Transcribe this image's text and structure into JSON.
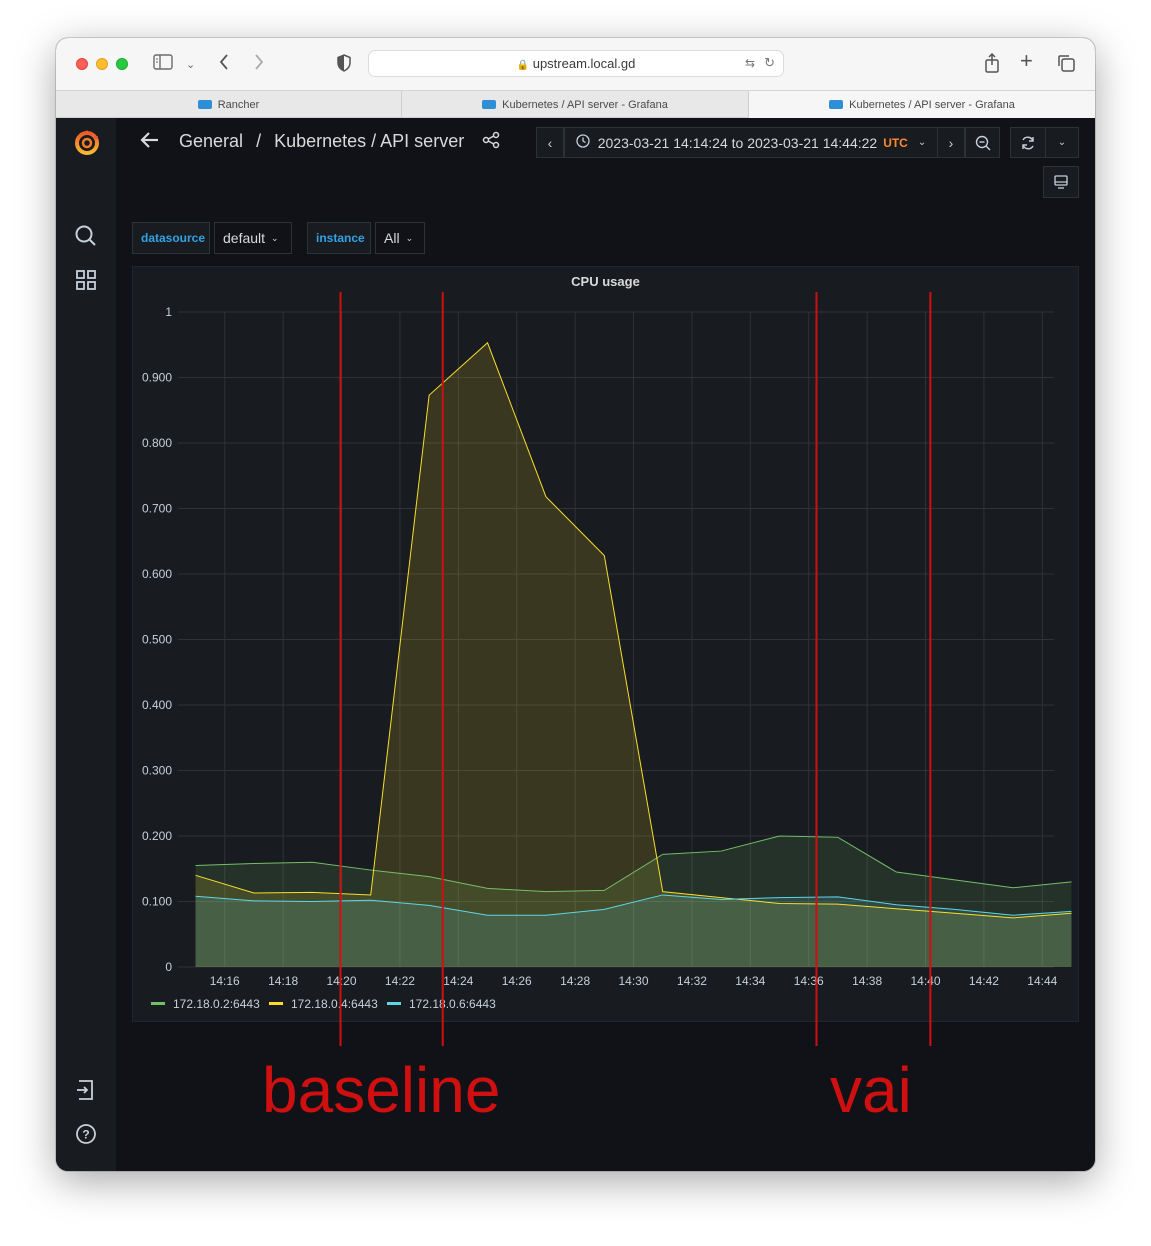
{
  "browser": {
    "url": "upstream.local.gd",
    "tabs": [
      {
        "label": "Rancher",
        "active": false
      },
      {
        "label": "Kubernetes / API server - Grafana",
        "active": false
      },
      {
        "label": "Kubernetes / API server - Grafana",
        "active": true
      }
    ]
  },
  "header": {
    "breadcrumb_folder": "General",
    "breadcrumb_sep": "/",
    "dashboard_title": "Kubernetes / API server",
    "time_range": "2023-03-21 14:14:24 to 2023-03-21 14:44:22",
    "timezone": "UTC"
  },
  "variables": [
    {
      "label": "datasource",
      "value": "default"
    },
    {
      "label": "instance",
      "value": "All"
    }
  ],
  "panel": {
    "title": "CPU usage"
  },
  "annotations": {
    "left_label": "baseline",
    "right_label": "vai",
    "color": "#d01010",
    "marker_times": [
      "14:20",
      "14:23.5",
      "14:36.3",
      "14:40.2"
    ]
  },
  "colors": {
    "series_green": "#73bf69",
    "series_yellow": "#fade2a",
    "series_blue": "#5fd6e8",
    "accent_orange": "#ff8833",
    "link_blue": "#33a2e5"
  },
  "chart_data": {
    "type": "area",
    "title": "CPU usage",
    "x": [
      "14:15",
      "14:17",
      "14:19",
      "14:21",
      "14:23",
      "14:25",
      "14:27",
      "14:29",
      "14:31",
      "14:33",
      "14:35",
      "14:37",
      "14:39",
      "14:41",
      "14:43",
      "14:45"
    ],
    "x_ticks": [
      "14:16",
      "14:18",
      "14:20",
      "14:22",
      "14:24",
      "14:26",
      "14:28",
      "14:30",
      "14:32",
      "14:34",
      "14:36",
      "14:38",
      "14:40",
      "14:42",
      "14:44"
    ],
    "y_ticks": [
      "0",
      "0.100",
      "0.200",
      "0.300",
      "0.400",
      "0.500",
      "0.600",
      "0.700",
      "0.800",
      "0.900",
      "1"
    ],
    "ylim": [
      0,
      1
    ],
    "grid": true,
    "legend": "bottom-left",
    "series": [
      {
        "name": "172.18.0.2:6443",
        "color": "#73bf69",
        "values": [
          0.155,
          0.158,
          0.16,
          0.148,
          0.138,
          0.12,
          0.115,
          0.117,
          0.172,
          0.177,
          0.2,
          0.198,
          0.145,
          0.133,
          0.121,
          0.13
        ]
      },
      {
        "name": "172.18.0.4:6443",
        "color": "#fade2a",
        "values": [
          0.14,
          0.113,
          0.114,
          0.11,
          0.873,
          0.953,
          0.718,
          0.628,
          0.115,
          0.106,
          0.097,
          0.096,
          0.089,
          0.082,
          0.075,
          0.082
        ]
      },
      {
        "name": "172.18.0.6:6443",
        "color": "#5fd6e8",
        "values": [
          0.108,
          0.101,
          0.1,
          0.102,
          0.094,
          0.079,
          0.079,
          0.088,
          0.11,
          0.103,
          0.106,
          0.107,
          0.095,
          0.088,
          0.079,
          0.085
        ]
      }
    ]
  }
}
